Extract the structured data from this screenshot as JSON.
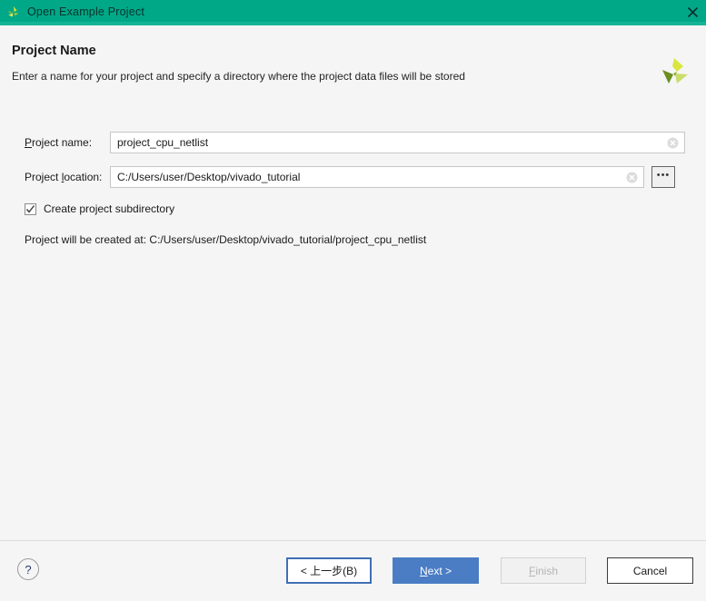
{
  "window": {
    "title": "Open Example Project",
    "icon": "vivado-app-icon",
    "close_label": "✕",
    "titlebar_color": "#00a887"
  },
  "header": {
    "title": "Project Name",
    "subtitle": "Enter a name for your project and specify a directory where the project data files will be stored",
    "logo": "xilinx-logo"
  },
  "form": {
    "project_name": {
      "label_prefix": "P",
      "label_rest": "roject name:",
      "value": "project_cpu_netlist",
      "clear_icon": "clear-circle-icon"
    },
    "project_location": {
      "label_prefix_a": "Project ",
      "label_mnemonic": "l",
      "label_rest": "ocation:",
      "value": "C:/Users/user/Desktop/vivado_tutorial",
      "clear_icon": "clear-circle-icon",
      "browse_label": "•••"
    },
    "create_subdirectory": {
      "label": "Create project subdirectory",
      "checked": true
    },
    "created_at_note": "Project will be created at: C:/Users/user/Desktop/vivado_tutorial/project_cpu_netlist"
  },
  "footer": {
    "help_label": "?",
    "back_label": "< 上一步(B)",
    "next_label_prefix": "N",
    "next_label_rest": "ext >",
    "finish_label_prefix": "F",
    "finish_label_rest": "inish",
    "cancel_label": "Cancel",
    "accent_color": "#4a7dc4"
  }
}
